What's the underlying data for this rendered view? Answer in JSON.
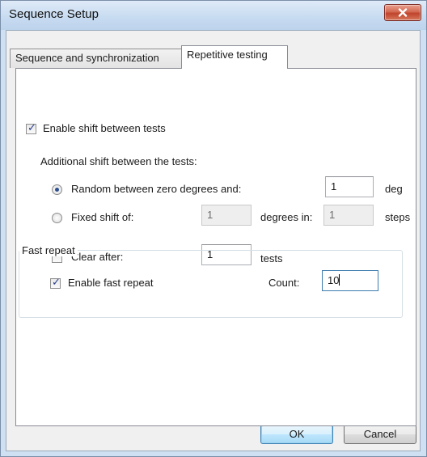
{
  "window": {
    "title": "Sequence Setup"
  },
  "tabs": [
    {
      "label": "Sequence and synchronization",
      "active": false
    },
    {
      "label": "Repetitive testing",
      "active": true
    }
  ],
  "repetitive": {
    "enable_shift": {
      "label": "Enable shift between tests",
      "checked": true
    },
    "additional_shift_label": "Additional shift between the tests:",
    "random": {
      "label": "Random between zero degrees and:",
      "selected": true,
      "value": "1",
      "unit": "deg"
    },
    "fixed": {
      "label": "Fixed shift of:",
      "selected": false,
      "value": "1",
      "degrees_in_label": "degrees in:",
      "steps_value": "1",
      "steps_unit": "steps"
    },
    "clear_after": {
      "label": "Clear after:",
      "checked": false,
      "value": "1",
      "unit": "tests"
    },
    "fast_repeat": {
      "title": "Fast repeat",
      "enable": {
        "label": "Enable fast repeat",
        "checked": true
      },
      "count_label": "Count:",
      "count_value": "10"
    }
  },
  "buttons": {
    "ok": "OK",
    "cancel": "Cancel"
  },
  "colors": {
    "title_bar": "#c8dcf1",
    "close_button": "#c0432b",
    "default_button": "#bee6fd",
    "check_mark": "#2a3f8f"
  }
}
